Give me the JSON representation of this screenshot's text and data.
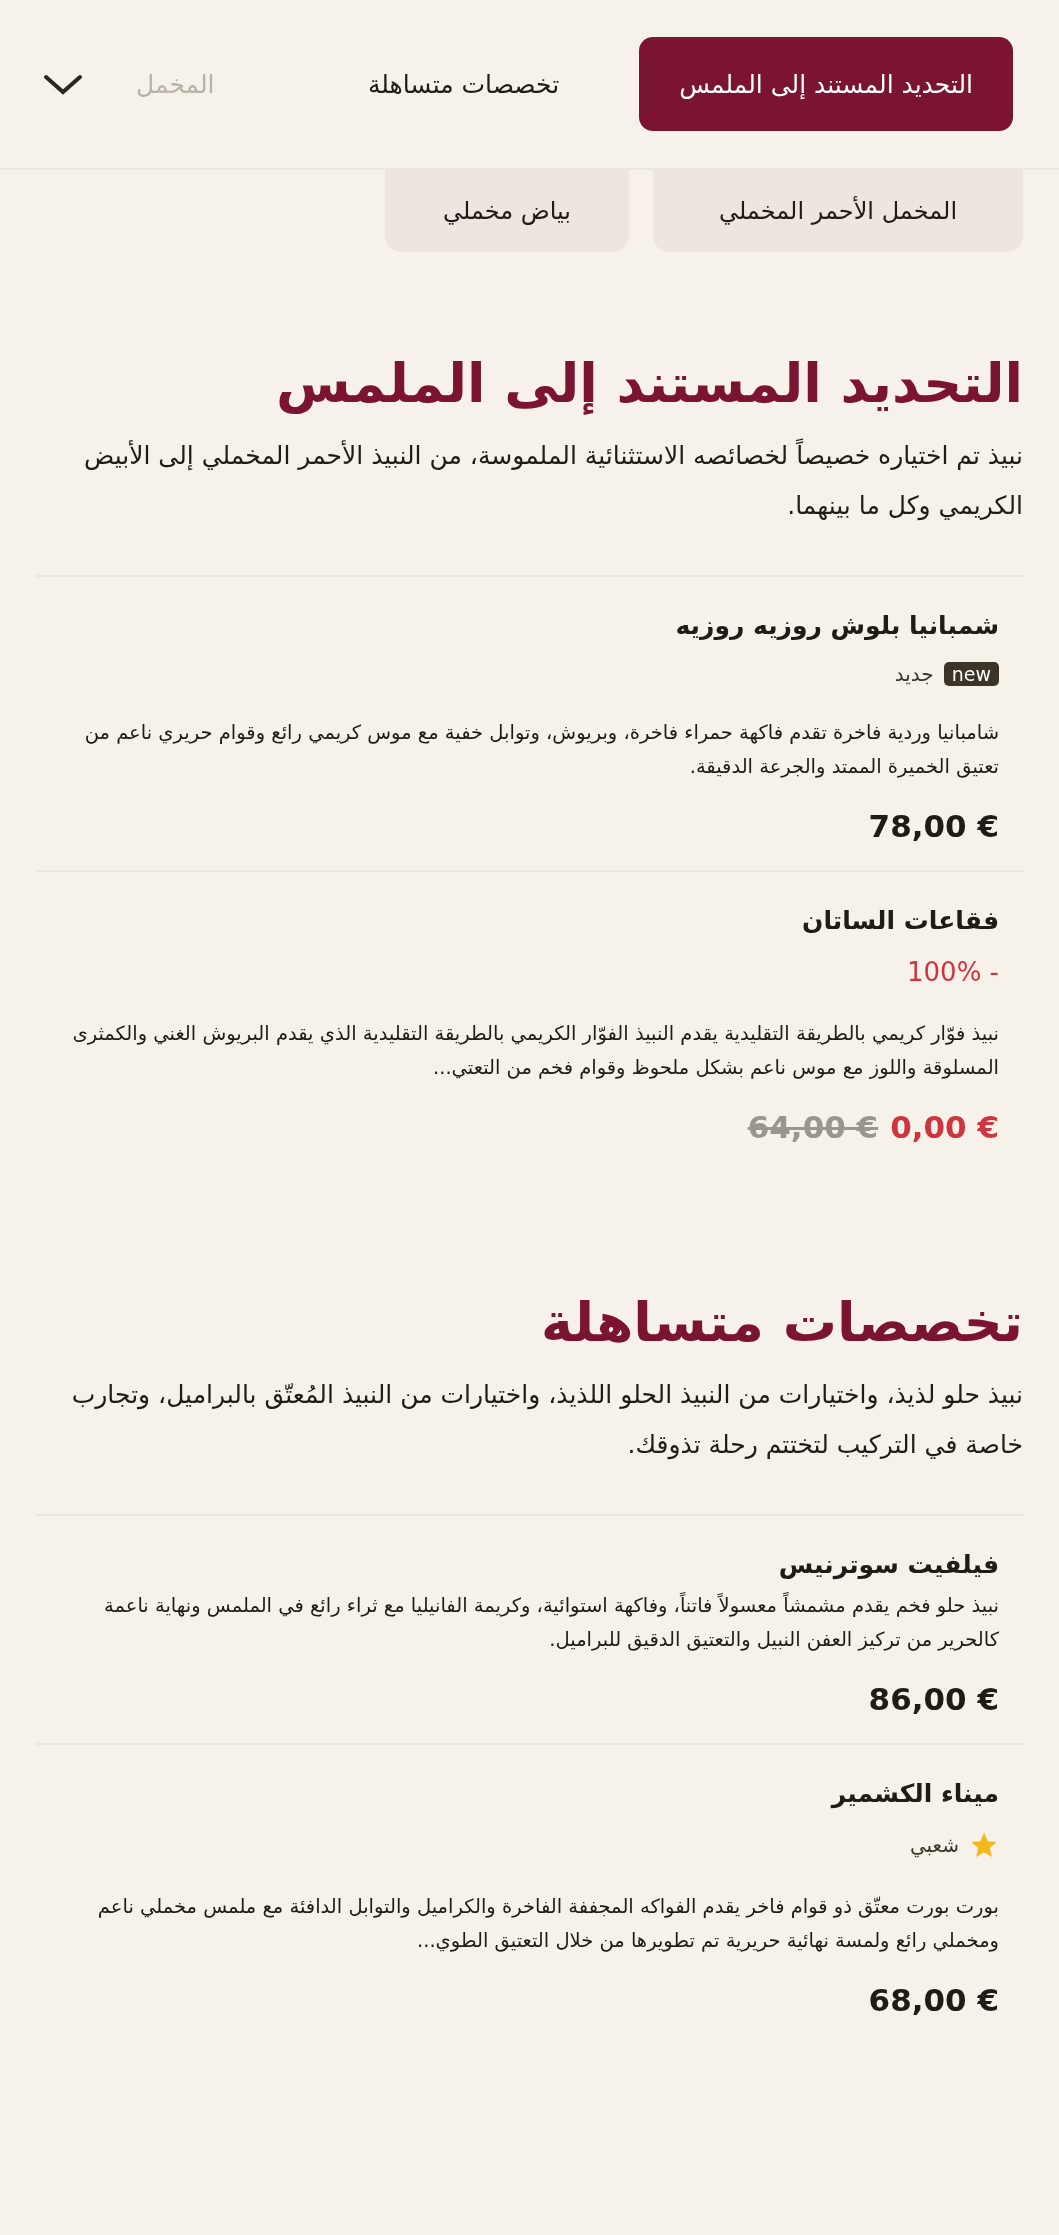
{
  "nav": {
    "tabs": [
      {
        "label": "التحديد المستند إلى الملمس",
        "selected": true
      },
      {
        "label": "تخصصات متساهلة",
        "selected": false
      },
      {
        "label": "المخمل",
        "selected": false
      }
    ]
  },
  "chips": [
    "المخمل الأحمر المخملي",
    "بياض مخملي"
  ],
  "sections": [
    {
      "title": "التحديد المستند إلى الملمس",
      "description": "نبيذ تم اختياره خصيصاً لخصائصه الاستثنائية الملموسة، من النبيذ الأحمر المخملي إلى الأبيض الكريمي وكل ما بينهما.",
      "products": [
        {
          "name": "شمبانيا بلوش روزيه روزيه",
          "tag": {
            "kind": "new",
            "badge": "new",
            "label": "جديد"
          },
          "description": "شامبانيا وردية فاخرة تقدم فاكهة حمراء فاخرة، وبريوش، وتوابل خفية مع موس كريمي رائع وقوام حريري ناعم من تعتيق الخميرة الممتد والجرعة الدقيقة.",
          "price": "78,00 €"
        },
        {
          "name": "فقاعات الساتان",
          "discount": "- 100%",
          "description": "نبيذ فوّار كريمي بالطريقة التقليدية يقدم النبيذ الفوّار الكريمي بالطريقة التقليدية الذي يقدم البريوش الغني والكمثرى المسلوقة واللوز مع موس ناعم بشكل ملحوظ وقوام فخم من التعتي...",
          "price": "0,00 €",
          "old_price": "64,00 €"
        }
      ]
    },
    {
      "title": "تخصصات متساهلة",
      "description": "نبيذ حلو لذيذ، واختيارات من النبيذ الحلو اللذيذ، واختيارات من النبيذ المُعتّق بالبراميل، وتجارب خاصة في التركيب لتختتم رحلة تذوقك.",
      "products": [
        {
          "name": "فيلفيت سوترنيس",
          "description": "نبيذ حلو فخم يقدم مشمشاً معسولاً فاتناً، وفاكهة استوائية، وكريمة الفانيليا مع ثراء رائع في الملمس ونهاية ناعمة كالحرير من تركيز العفن النبيل والتعتيق الدقيق للبراميل.",
          "price": "86,00 €"
        },
        {
          "name": "ميناء الكشمير",
          "tag": {
            "kind": "star",
            "label": "شعبي"
          },
          "description": "بورت بورت معتّق ذو قوام فاخر يقدم الفواكه المجففة الفاخرة والكراميل والتوابل الدافئة مع ملمس مخملي ناعم ومخملي رائع ولمسة نهائية حريرية تم تطويرها من خلال التعتيق الطوي...",
          "price": "68,00 €"
        }
      ]
    }
  ]
}
